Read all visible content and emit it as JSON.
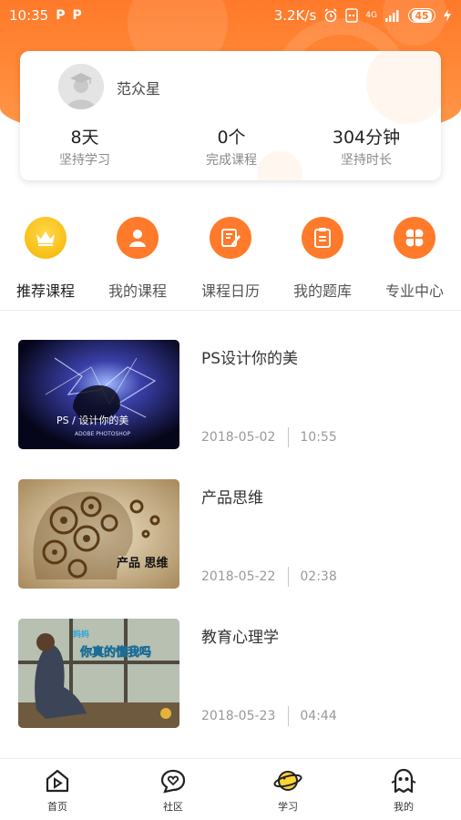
{
  "status_bar": {
    "time": "10:35",
    "app_icons": [
      "P",
      "P"
    ],
    "network_speed": "3.2K/s",
    "network_type": "4G",
    "battery": "45"
  },
  "profile": {
    "name": "范众星",
    "stats": [
      {
        "value": "8天",
        "label": "坚持学习"
      },
      {
        "value": "0个",
        "label": "完成课程"
      },
      {
        "value": "304分钟",
        "label": "坚持时长"
      }
    ]
  },
  "nav": [
    {
      "label": "推荐课程",
      "icon": "crown-icon"
    },
    {
      "label": "我的课程",
      "icon": "user-icon"
    },
    {
      "label": "课程日历",
      "icon": "notebook-pen-icon"
    },
    {
      "label": "我的题库",
      "icon": "clipboard-icon"
    },
    {
      "label": "专业中心",
      "icon": "grid-flower-icon"
    }
  ],
  "courses": [
    {
      "title": "PS设计你的美",
      "date": "2018-05-02",
      "duration": "10:55",
      "thumb_text": "PS / 设计你的美",
      "thumb_sub": "ADOBE  PHOTOSHOP"
    },
    {
      "title": "产品思维",
      "date": "2018-05-22",
      "duration": "02:38",
      "thumb_text": "产品 思维"
    },
    {
      "title": "教育心理学",
      "date": "2018-05-23",
      "duration": "04:44",
      "thumb_text": "你真的懂我吗",
      "thumb_sub": "妈妈"
    }
  ],
  "tabbar": [
    {
      "label": "首页",
      "icon": "home-play-icon"
    },
    {
      "label": "社区",
      "icon": "heart-chat-icon"
    },
    {
      "label": "学习",
      "icon": "planet-icon"
    },
    {
      "label": "我的",
      "icon": "mascot-icon"
    }
  ],
  "colors": {
    "accent": "#ff7a2a",
    "gold": "#f5b400"
  }
}
